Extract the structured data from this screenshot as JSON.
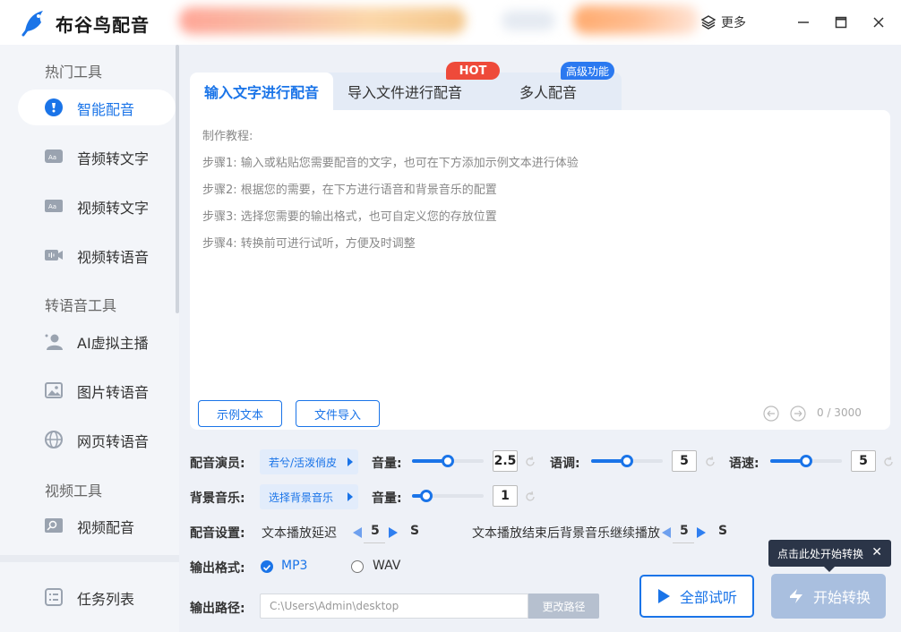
{
  "app": {
    "name": "布谷鸟配音"
  },
  "titlebar": {
    "more_label": "更多"
  },
  "sidebar": {
    "sections": [
      "热门工具",
      "转语音工具",
      "视频工具"
    ],
    "items": [
      {
        "label": "智能配音",
        "icon": "smart-dub-icon",
        "active": true
      },
      {
        "label": "音频转文字",
        "icon": "audio-text-icon"
      },
      {
        "label": "视频转文字",
        "icon": "video-text-icon"
      },
      {
        "label": "视频转语音",
        "icon": "video-voice-icon"
      },
      {
        "label": "AI虚拟主播",
        "icon": "ai-anchor-icon"
      },
      {
        "label": "图片转语音",
        "icon": "image-voice-icon"
      },
      {
        "label": "网页转语音",
        "icon": "web-voice-icon"
      },
      {
        "label": "视频配音",
        "icon": "video-dub-icon"
      }
    ],
    "task_list": "任务列表"
  },
  "tabs": [
    {
      "label": "输入文字进行配音",
      "active": true
    },
    {
      "label": "导入文件进行配音"
    },
    {
      "label": "多人配音"
    }
  ],
  "badges": {
    "hot": "HOT",
    "advanced": "高级功能"
  },
  "editor": {
    "lines": [
      "制作教程:",
      "步骤1: 输入或粘贴您需要配音的文字，也可在下方添加示例文本进行体验",
      "步骤2: 根据您的需要，在下方进行语音和背景音乐的配置",
      "步骤3: 选择您需要的输出格式，也可自定义您的存放位置",
      "步骤4: 转换前可进行试听，方便及时调整"
    ],
    "sample_button": "示例文本",
    "import_button": "文件导入",
    "counter": "0 / 3000"
  },
  "voice": {
    "label": "配音演员:",
    "value": "若兮/活泼俏皮",
    "volume_label": "音量:",
    "volume_value": "2.5",
    "volume_fraction": 0.5,
    "pitch_label": "语调:",
    "pitch_value": "5",
    "pitch_fraction": 0.5,
    "speed_label": "语速:",
    "speed_value": "5",
    "speed_fraction": 0.5
  },
  "bgm": {
    "label": "背景音乐:",
    "value": "选择背景音乐",
    "volume_label": "音量:",
    "volume_value": "1",
    "volume_fraction": 0.2
  },
  "settings": {
    "label": "配音设置:",
    "delay_label": "文本播放延迟",
    "delay_value": "5",
    "delay_unit": "S",
    "continue_label": "文本播放结束后背景音乐继续播放",
    "continue_value": "5",
    "continue_unit": "S"
  },
  "output": {
    "format_label": "输出格式:",
    "formats": [
      {
        "label": "MP3",
        "checked": true
      },
      {
        "label": "WAV",
        "checked": false
      }
    ],
    "path_label": "输出路径:",
    "path_value": "C:\\Users\\Admin\\desktop",
    "change_path": "更改路径"
  },
  "actions": {
    "preview_all": "全部试听",
    "start": "开始转换",
    "tooltip": "点击此处开始转换"
  },
  "colors": {
    "accent": "#1a74e8",
    "hot": "#ee4a3a",
    "start_disabled": "#a9bfdf"
  }
}
